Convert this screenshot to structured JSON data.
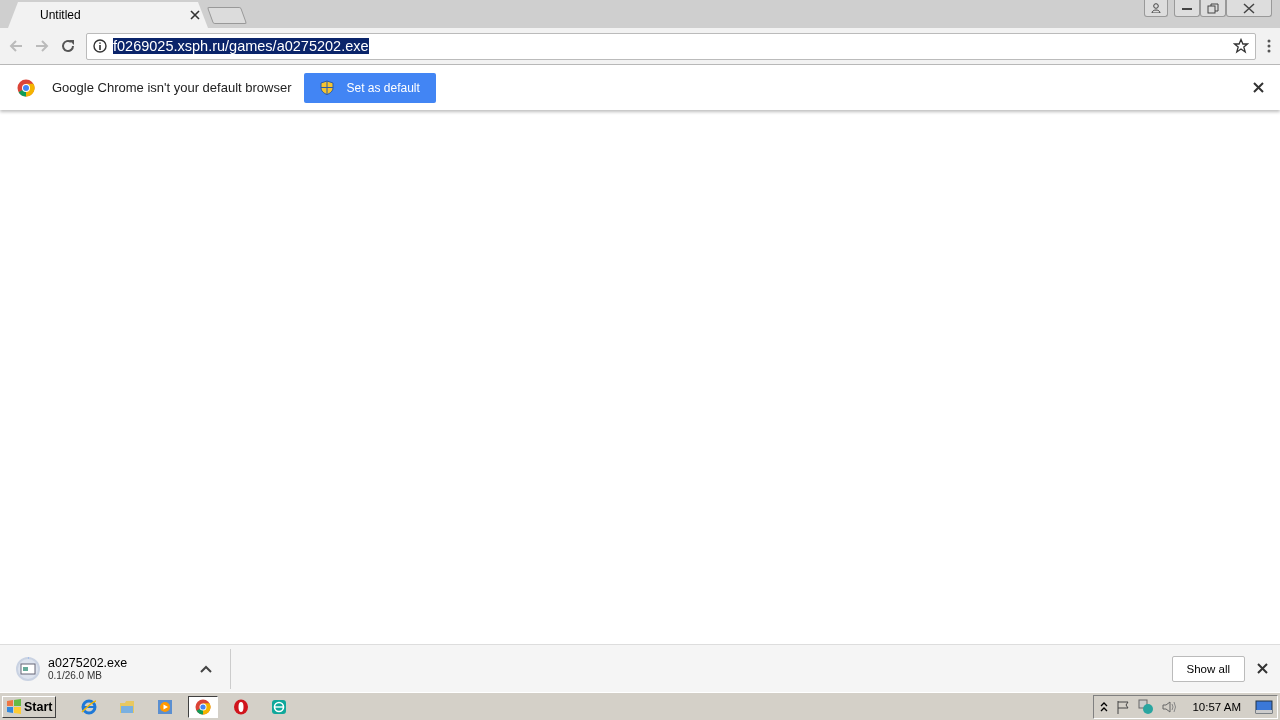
{
  "tabs": [
    {
      "title": "Untitled",
      "selected": true
    }
  ],
  "address": {
    "value": "f0269025.xsph.ru/games/a0275202.exe",
    "highlighted": true
  },
  "infobar": {
    "message": "Google Chrome isn't your default browser",
    "button": "Set as default"
  },
  "download": {
    "filename": "a0275202.exe",
    "progress": "0.1/26.0 MB",
    "level": 0.004,
    "show_all": "Show all"
  },
  "taskbar": {
    "start": "Start",
    "apps": [
      {
        "kind": "ie",
        "selected": false
      },
      {
        "kind": "folder",
        "selected": false
      },
      {
        "kind": "media",
        "selected": false
      },
      {
        "kind": "chrome",
        "selected": true
      },
      {
        "kind": "opera",
        "selected": false
      },
      {
        "kind": "eset",
        "selected": false
      }
    ],
    "clock": "10:57 AM"
  }
}
